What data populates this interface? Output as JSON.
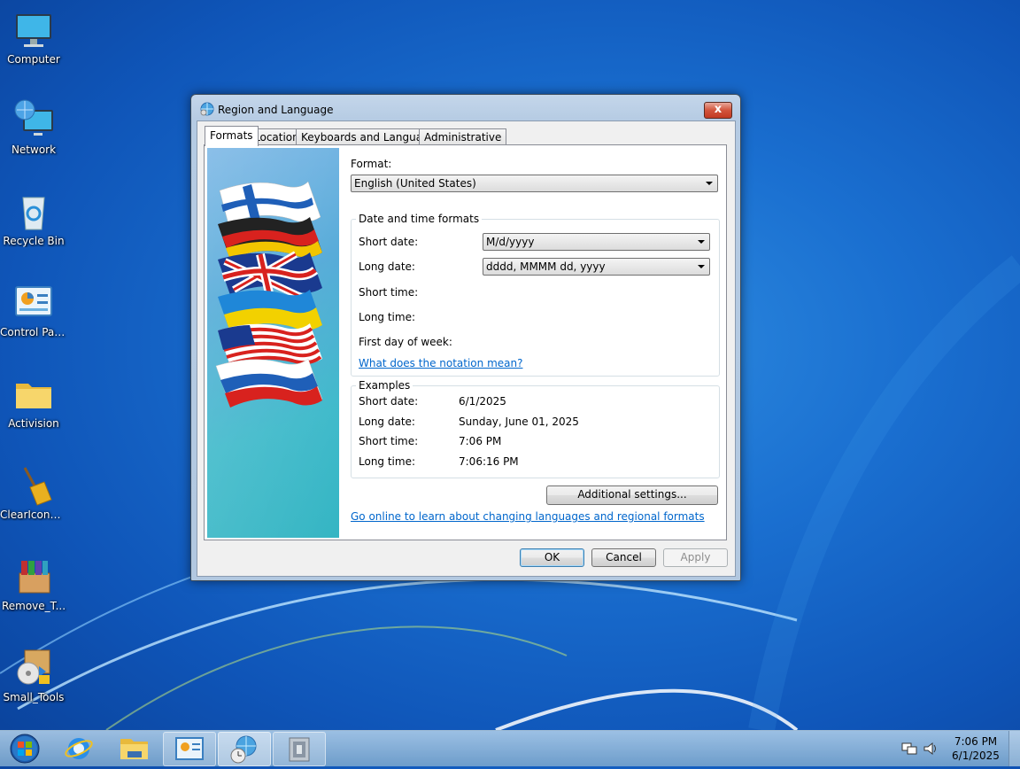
{
  "desktop": {
    "icons": [
      {
        "label": "Computer"
      },
      {
        "label": "Network"
      },
      {
        "label": "Recycle Bin"
      },
      {
        "label": "Control Panel"
      },
      {
        "label": "Activision"
      },
      {
        "label": "ClearIconC..."
      },
      {
        "label": "Remove_T..."
      },
      {
        "label": "Small_Tools"
      }
    ]
  },
  "window": {
    "title": "Region and Language",
    "close_label": "x",
    "tabs": [
      {
        "label": "Formats"
      },
      {
        "label": "Location"
      },
      {
        "label": "Keyboards and Languages"
      },
      {
        "label": "Administrative"
      }
    ],
    "formats": {
      "format_label": "Format:",
      "format_value": "English (United States)",
      "date_time_group": "Date and time formats",
      "short_date_label": "Short date:",
      "short_date_value": "M/d/yyyy",
      "long_date_label": "Long date:",
      "long_date_value": "dddd, MMMM dd, yyyy",
      "short_time_label": "Short time:",
      "long_time_label": "Long time:",
      "first_day_label": "First day of week:",
      "notation_link": "What does the notation mean?",
      "examples_group": "Examples",
      "examples": [
        {
          "label": "Short date:",
          "value": "6/1/2025"
        },
        {
          "label": "Long date:",
          "value": "Sunday, June 01, 2025"
        },
        {
          "label": "Short time:",
          "value": "7:06 PM"
        },
        {
          "label": "Long time:",
          "value": "7:06:16 PM"
        }
      ],
      "additional_settings": "Additional settings...",
      "online_link": "Go online to learn about changing languages and regional formats"
    },
    "buttons": {
      "ok": "OK",
      "cancel": "Cancel",
      "apply": "Apply"
    }
  },
  "taskbar": {
    "time": "7:06 PM",
    "date": "6/1/2025"
  }
}
